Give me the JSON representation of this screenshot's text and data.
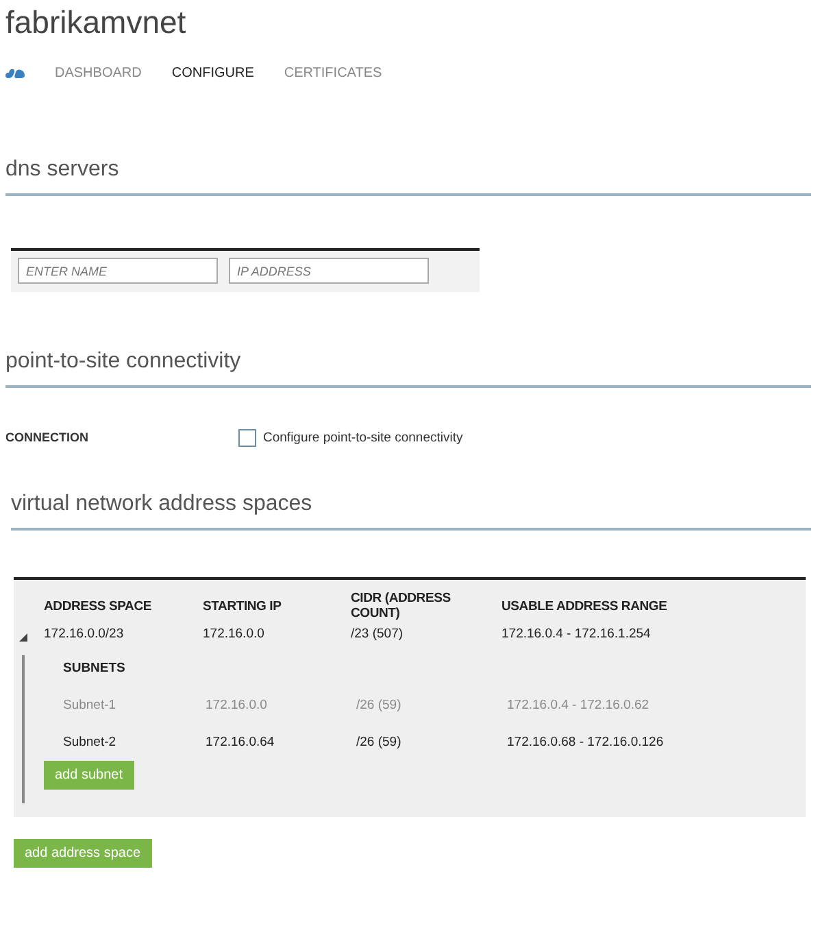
{
  "title": "fabrikamvnet",
  "tabs": [
    {
      "label": "DASHBOARD",
      "selected": false
    },
    {
      "label": "CONFIGURE",
      "selected": true
    },
    {
      "label": "CERTIFICATES",
      "selected": false
    }
  ],
  "dns_servers": {
    "heading": "dns servers",
    "name_field": {
      "placeholder": "ENTER NAME"
    },
    "address_field": {
      "placeholder": "IP ADDRESS"
    }
  },
  "point_to_site": {
    "heading": "point-to-site connectivity",
    "label": "CONNECTION",
    "checkbox": {
      "label": "Configure point-to-site connectivity",
      "checked": false
    }
  },
  "address_spaces": {
    "heading": "virtual network address spaces",
    "columns": [
      "ADDRESS SPACE",
      "STARTING IP",
      "CIDR (ADDRESS COUNT)",
      "USABLE ADDRESS RANGE"
    ],
    "rows": [
      {
        "expanded": true,
        "cells": [
          "172.16.0.0/23",
          "172.16.0.0",
          "/23 (507)",
          "172.16.0.4 - 172.16.1.254"
        ],
        "subnets_label": "SUBNETS",
        "subnets": [
          {
            "dimmed": true,
            "cells": [
              "Subnet-1",
              "172.16.0.0",
              "/26 (59)",
              "172.16.0.4 - 172.16.0.62"
            ]
          },
          {
            "dimmed": false,
            "cells": [
              "Subnet-2",
              "172.16.0.64",
              "/26 (59)",
              "172.16.0.68 - 172.16.0.126"
            ]
          }
        ],
        "add_subnet": "add subnet"
      }
    ],
    "add_address_space": "add address space"
  }
}
